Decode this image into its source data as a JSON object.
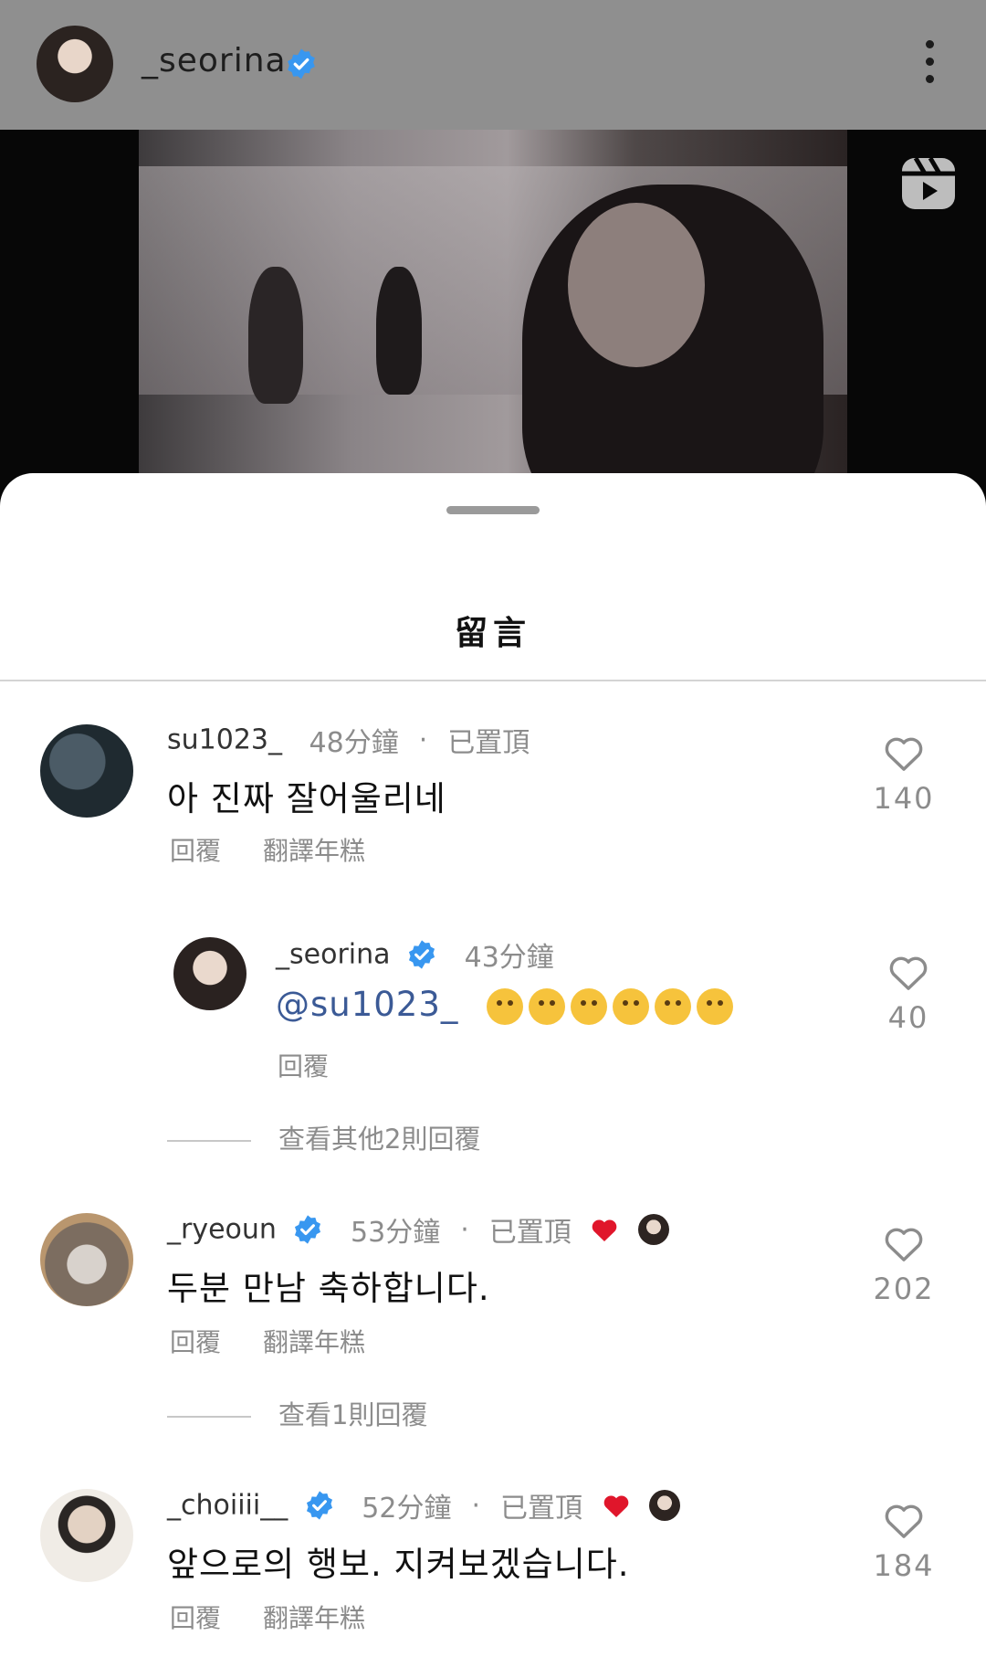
{
  "header": {
    "username": "_seorina"
  },
  "sheet": {
    "title": "留言"
  },
  "comments": [
    {
      "username": "su1023_",
      "time": "48分鐘",
      "pinned": "已置頂",
      "text": "아 진짜 잘어울리네",
      "reply": "回覆",
      "translate": "翻譯年糕",
      "likes": "140"
    },
    {
      "username": "_ryeoun",
      "time": "53分鐘",
      "pinned": "已置頂",
      "text": "두분 만남 축하합니다.",
      "reply": "回覆",
      "translate": "翻譯年糕",
      "likes": "202",
      "view_replies": "查看1則回覆"
    },
    {
      "username": "_choiiii__",
      "time": "52分鐘",
      "pinned": "已置頂",
      "text": "앞으로의 행보. 지켜보겠습니다.",
      "reply": "回覆",
      "translate": "翻譯年糕",
      "likes": "184"
    }
  ],
  "reply_comment": {
    "username": "_seorina",
    "time": "43分鐘",
    "mention": "@su1023_",
    "reply": "回覆",
    "likes": "40",
    "view_replies": "查看其他2則回覆"
  },
  "colors": {
    "verified": "#3897f0",
    "heart": "#e0162b",
    "muted": "#8c8c8c"
  },
  "icons": [
    "verified-badge-icon",
    "more-options-icon",
    "reels-icon",
    "heart-outline-icon",
    "heart-filled-icon"
  ]
}
